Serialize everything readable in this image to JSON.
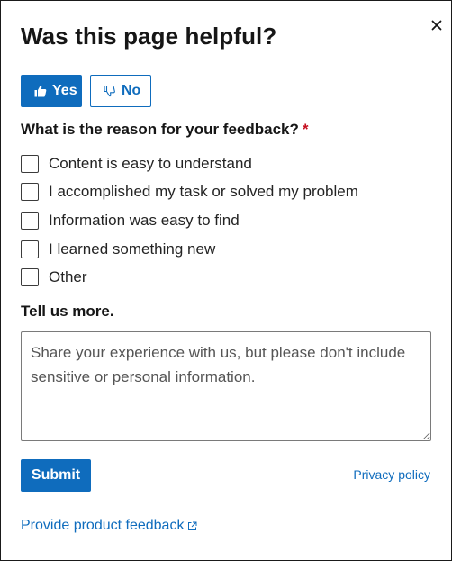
{
  "dialog": {
    "title": "Was this page helpful?",
    "close_icon": "close-icon"
  },
  "vote": {
    "yes_label": "Yes",
    "yes_icon": "thumbs-up-icon",
    "no_label": "No",
    "no_icon": "thumbs-down-icon",
    "selected": "Yes"
  },
  "reason": {
    "question": "What is the reason for your feedback?",
    "required_marker": "*",
    "options": [
      {
        "label": "Content is easy to understand",
        "checked": false
      },
      {
        "label": "I accomplished my task or solved my problem",
        "checked": false
      },
      {
        "label": "Information was easy to find",
        "checked": false
      },
      {
        "label": "I learned something new",
        "checked": false
      },
      {
        "label": "Other",
        "checked": false
      }
    ]
  },
  "more": {
    "label": "Tell us more.",
    "value": "",
    "placeholder": "Share your experience with us, but please don't include sensitive or personal information."
  },
  "footer": {
    "submit_label": "Submit",
    "privacy_label": "Privacy policy",
    "product_feedback_label": "Provide product feedback",
    "external_link_icon": "external-link-icon"
  },
  "colors": {
    "accent": "#0f6cbd",
    "required": "#c50f1f",
    "border": "#1a1a1a"
  }
}
